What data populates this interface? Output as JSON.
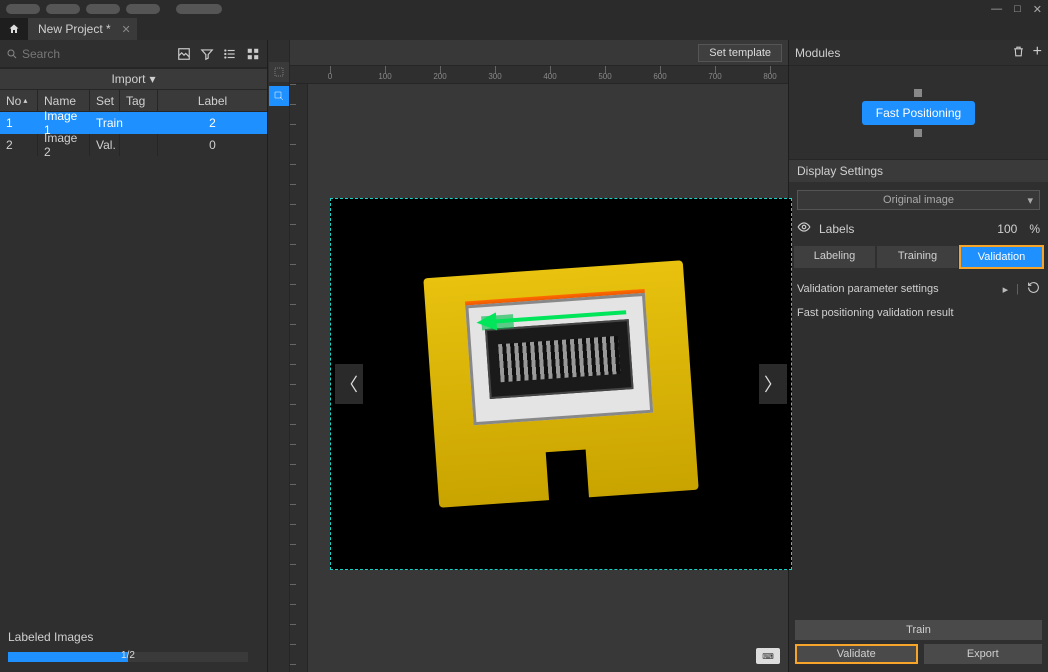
{
  "tab": {
    "title": "New Project *"
  },
  "search": {
    "placeholder": "Search"
  },
  "import_label": "Import",
  "table": {
    "headers": {
      "no": "No",
      "name": "Name",
      "set": "Set",
      "tag": "Tag",
      "label": "Label"
    },
    "rows": [
      {
        "no": "1",
        "name": "Image 1",
        "set": "Train",
        "tag": "",
        "label": "2",
        "selected": true
      },
      {
        "no": "2",
        "name": "Image 2",
        "set": "Val.",
        "tag": "",
        "label": "0",
        "selected": false
      }
    ]
  },
  "labeled_images": {
    "title": "Labeled Images",
    "text": "1/2",
    "percent": 50
  },
  "set_template": "Set template",
  "ruler_ticks": [
    "0",
    "100",
    "200",
    "300",
    "400",
    "500",
    "600",
    "700",
    "800"
  ],
  "right": {
    "modules_title": "Modules",
    "module_name": "Fast Positioning",
    "display_settings": "Display Settings",
    "image_mode": "Original image",
    "labels_word": "Labels",
    "labels_pct": "100",
    "pct_sym": "%",
    "tabs": {
      "labeling": "Labeling",
      "training": "Training",
      "validation": "Validation"
    },
    "param_settings": "Validation parameter settings",
    "result_title": "Fast positioning validation result",
    "train": "Train",
    "validate": "Validate",
    "export": "Export"
  }
}
